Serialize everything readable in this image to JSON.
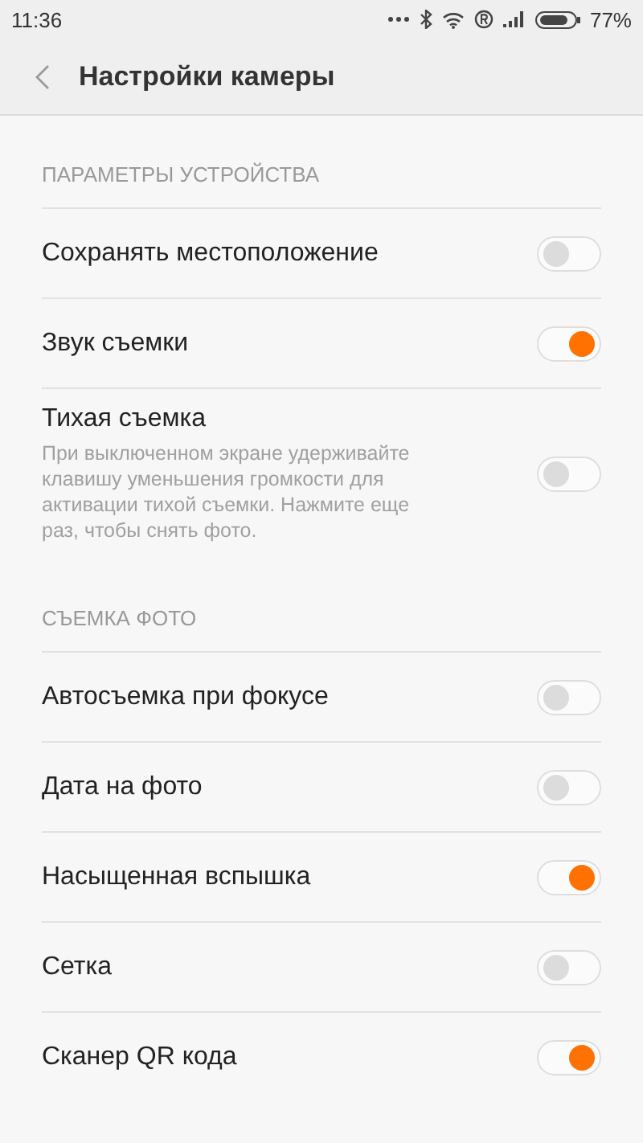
{
  "status_bar": {
    "time": "11:36",
    "battery": "77%"
  },
  "header": {
    "title": "Настройки камеры"
  },
  "sections": [
    {
      "title": "ПАРАМЕТРЫ УСТРОЙСТВА",
      "items": [
        {
          "label": "Сохранять местоположение",
          "on": false
        },
        {
          "label": "Звук съемки",
          "on": true
        },
        {
          "label": "Тихая съемка",
          "description": "При выключенном экране удерживайте клавишу уменьшения громкости для активации тихой съемки. Нажмите еще раз, чтобы снять фото.",
          "on": false
        }
      ]
    },
    {
      "title": "СЪЕМКА ФОТО",
      "items": [
        {
          "label": "Автосъемка при фокусе",
          "on": false
        },
        {
          "label": "Дата на фото",
          "on": false
        },
        {
          "label": "Насыщенная вспышка",
          "on": true
        },
        {
          "label": "Сетка",
          "on": false
        },
        {
          "label": "Сканер QR кода",
          "on": true
        }
      ]
    }
  ]
}
